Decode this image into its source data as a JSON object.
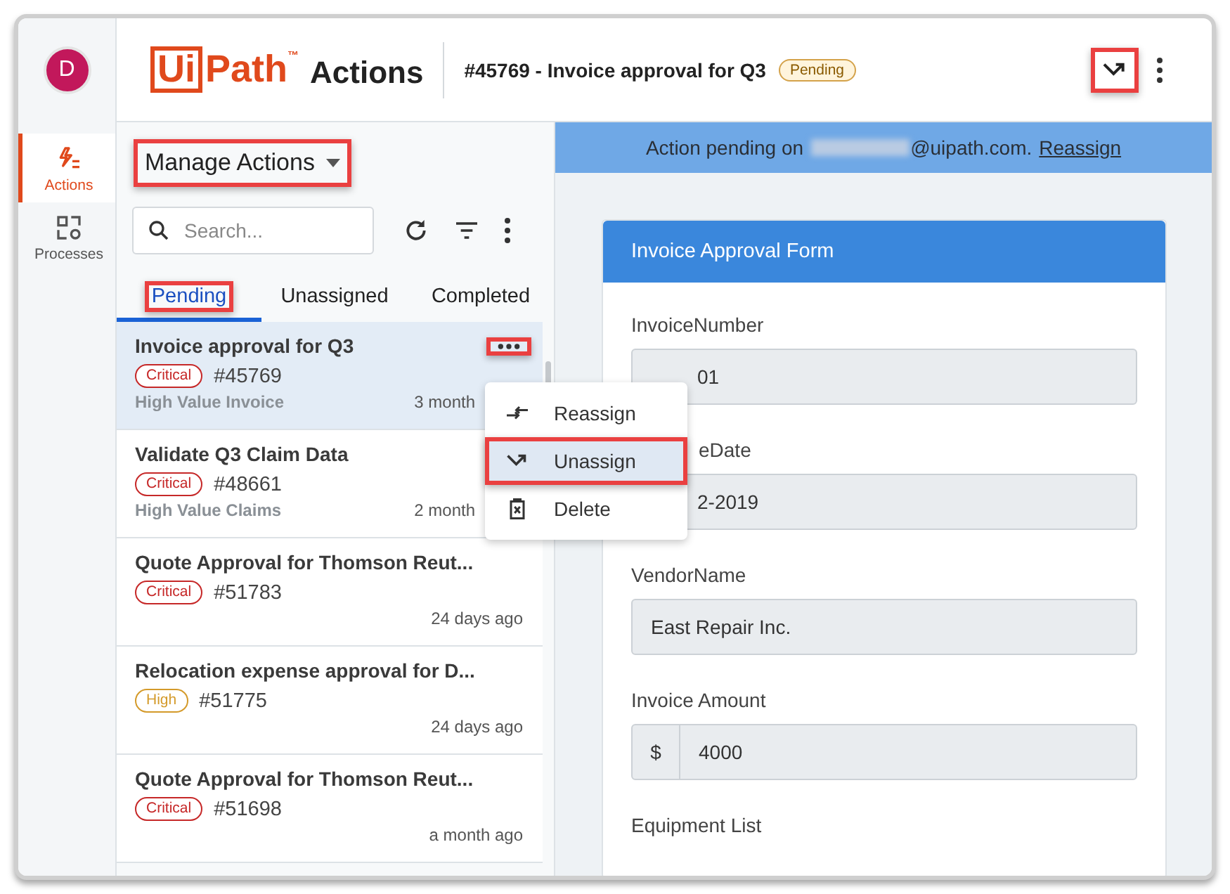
{
  "sidebar": {
    "avatar": "D",
    "items": [
      {
        "label": "Actions",
        "kind": "actions",
        "selected": true
      },
      {
        "label": "Processes",
        "kind": "processes",
        "selected": false
      }
    ]
  },
  "header": {
    "logo_mark": "Ui",
    "logo_word": "Path",
    "trademark": "™",
    "app_name": "Actions",
    "title": "#45769 - Invoice approval for Q3",
    "status": "Pending",
    "unassign_highlighted": true
  },
  "list": {
    "heading": "Manage Actions",
    "heading_highlighted": true,
    "search": {
      "placeholder": "Search..."
    },
    "tabs": [
      {
        "label": "Pending",
        "selected": true,
        "highlighted": true
      },
      {
        "label": "Unassigned",
        "selected": false,
        "highlighted": false
      },
      {
        "label": "Completed",
        "selected": false,
        "highlighted": false
      }
    ],
    "items": [
      {
        "title": "Invoice approval for Q3",
        "priority": "Critical",
        "color": "#c62828",
        "number": "#45769",
        "category": "High Value Invoice",
        "time": "3 month",
        "time_covered": true,
        "selected": true,
        "more_highlighted": true
      },
      {
        "title": "Validate Q3 Claim Data",
        "priority": "Critical",
        "color": "#c62828",
        "number": "#48661",
        "category": "High Value Claims",
        "time": "2 month",
        "time_covered": true,
        "selected": false
      },
      {
        "title": "Quote Approval for Thomson Reut...",
        "priority": "Critical",
        "color": "#c62828",
        "number": "#51783",
        "time": "24 days ago",
        "selected": false
      },
      {
        "title": "Relocation expense approval for D...",
        "priority": "High",
        "color": "#d49a2a",
        "number": "#51775",
        "time": "24 days ago",
        "selected": false
      },
      {
        "title": "Quote Approval for Thomson Reut...",
        "priority": "Critical",
        "color": "#c62828",
        "number": "#51698",
        "time": "a month ago",
        "selected": false
      }
    ]
  },
  "menu": {
    "items": [
      {
        "label": "Reassign",
        "kind": "reassign",
        "highlighted": false
      },
      {
        "label": "Unassign",
        "kind": "unassign",
        "highlighted": true
      },
      {
        "label": "Delete",
        "kind": "delete",
        "highlighted": false
      }
    ]
  },
  "banner": {
    "prefix": "Action pending on",
    "suffix": "@uipath.com.",
    "link": "Reassign"
  },
  "form": {
    "title": "Invoice Approval Form",
    "fields": [
      {
        "label": "InvoiceNumber",
        "value": "01",
        "value_covered": true
      },
      {
        "label": "eDate",
        "value": "2-2019",
        "label_covered": true,
        "value_covered": true
      },
      {
        "label": "VendorName",
        "value": "East Repair Inc."
      },
      {
        "label": "Invoice Amount",
        "prefix": "$",
        "value": "4000"
      }
    ],
    "next_label": "Equipment List"
  }
}
